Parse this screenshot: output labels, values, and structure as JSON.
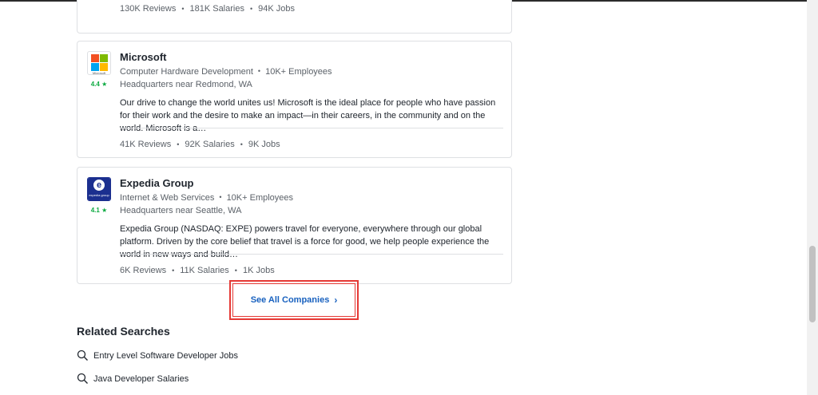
{
  "companies": [
    {
      "stats": {
        "reviews": "130K Reviews",
        "salaries": "181K Salaries",
        "jobs": "94K Jobs"
      }
    },
    {
      "name": "Microsoft",
      "logo_text": "Microsoft",
      "rating": "4.4 ★",
      "industry": "Computer Hardware Development",
      "size": "10K+ Employees",
      "hq": "Headquarters near Redmond, WA",
      "description": "Our drive to change the world unites us!  Microsoft is the ideal place for people who have passion for their work and the desire to make an impact—in their careers, in the community and on the world. Microsoft is a…",
      "stats": {
        "reviews": "41K Reviews",
        "salaries": "92K Salaries",
        "jobs": "9K Jobs"
      }
    },
    {
      "name": "Expedia Group",
      "logo_text": "expedia group",
      "rating": "4.1 ★",
      "industry": "Internet & Web Services",
      "size": "10K+ Employees",
      "hq": "Headquarters near Seattle, WA",
      "description": "Expedia Group (NASDAQ: EXPE) powers travel for everyone, everywhere through our global platform. Driven by the core belief that travel is a force for good, we help people experience the world in new ways and build…",
      "stats": {
        "reviews": "6K Reviews",
        "salaries": "11K Salaries",
        "jobs": "1K Jobs"
      }
    }
  ],
  "see_all": {
    "label": "See All Companies",
    "chevron": "›"
  },
  "related": {
    "title": "Related Searches",
    "items": [
      "Entry Level Software Developer Jobs",
      "Java Developer Salaries"
    ]
  },
  "colors": {
    "accent_link": "#1861bf",
    "rating_green": "#0caa41",
    "highlight_red": "#e53935",
    "microsoft": [
      "#f25022",
      "#7fba00",
      "#00a4ef",
      "#ffb900"
    ],
    "expedia": "#1b2f8f"
  }
}
